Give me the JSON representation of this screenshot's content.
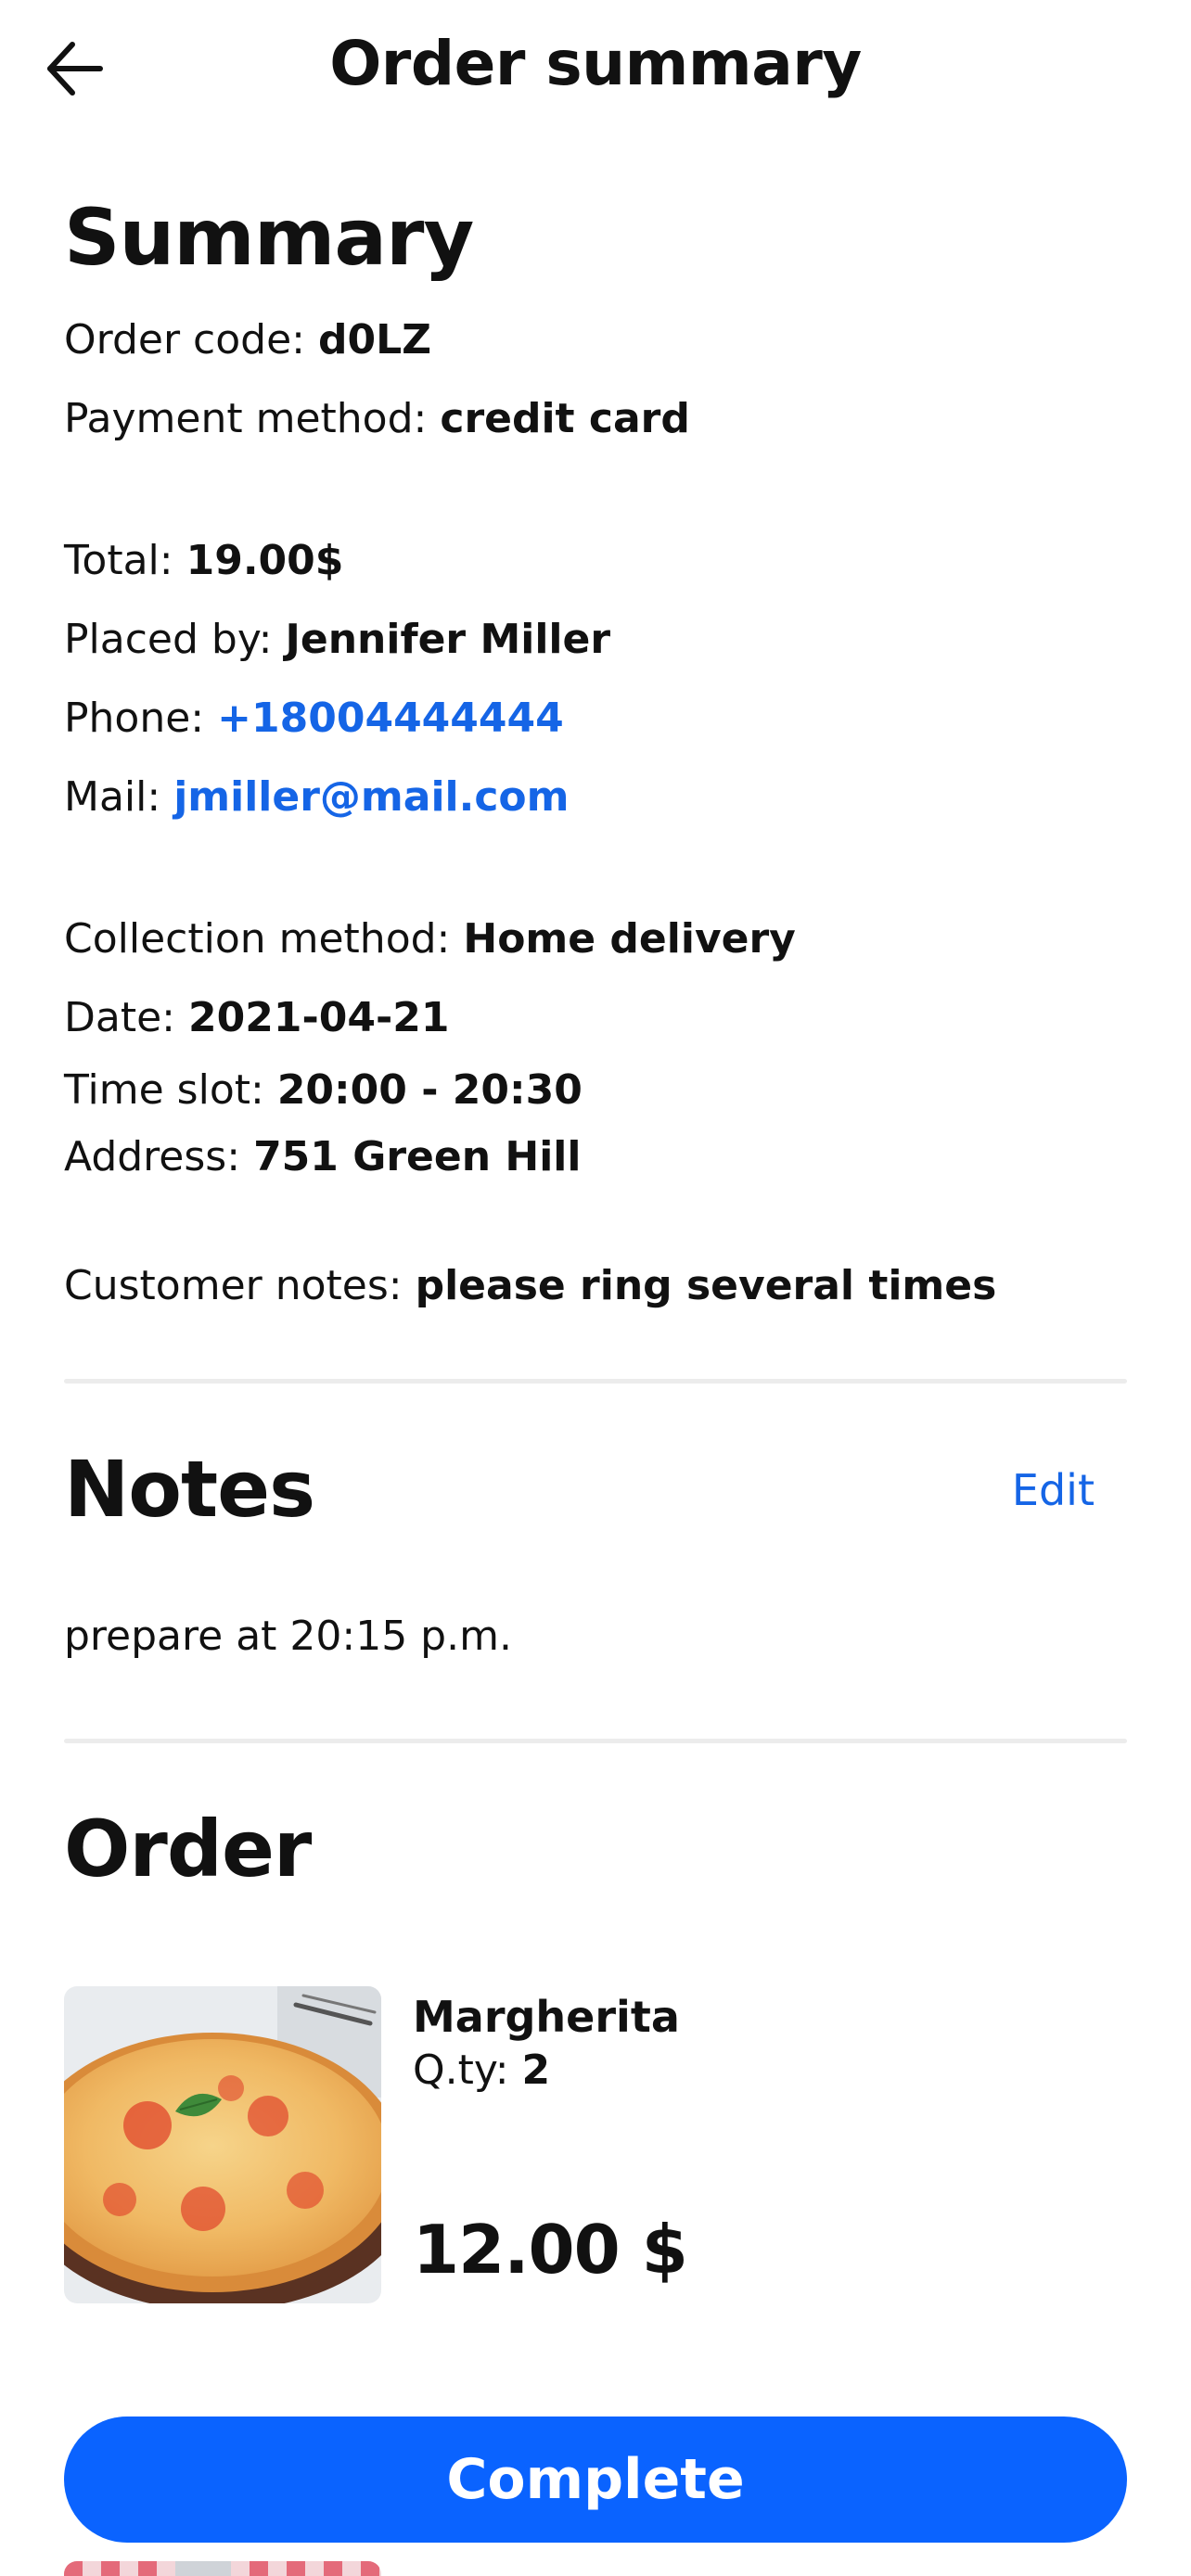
{
  "header": {
    "title": "Order summary",
    "back_icon": "arrow-left-icon"
  },
  "summary": {
    "title": "Summary",
    "order_code_label": "Order code:",
    "order_code": "d0LZ",
    "payment_method_label": "Payment method:",
    "payment_method": "credit card",
    "total_label": "Total:",
    "total": "19.00$",
    "placed_by_label": "Placed by:",
    "placed_by": "Jennifer Miller",
    "phone_label": "Phone:",
    "phone": "+18004444444",
    "mail_label": "Mail:",
    "mail": "jmiller@mail.com",
    "collection_method_label": "Collection method:",
    "collection_method": "Home delivery",
    "date_label": "Date:",
    "date": "2021-04-21",
    "time_slot_label": "Time slot:",
    "time_slot": "20:00 - 20:30",
    "address_label": "Address:",
    "address": "751 Green Hill",
    "customer_notes_label": "Customer notes:",
    "customer_notes": "please ring several times"
  },
  "notes": {
    "title": "Notes",
    "edit_label": "Edit",
    "text": "prepare at 20:15 p.m."
  },
  "order": {
    "title": "Order",
    "items": [
      {
        "name": "Margherita",
        "qty_label": "Q.ty:",
        "qty": "2",
        "price": "12.00 $",
        "image_icon": "pizza-photo"
      }
    ]
  },
  "actions": {
    "complete_label": "Complete"
  },
  "colors": {
    "accent": "#0a63ff",
    "link": "#1565e6",
    "divider": "#ececec"
  }
}
